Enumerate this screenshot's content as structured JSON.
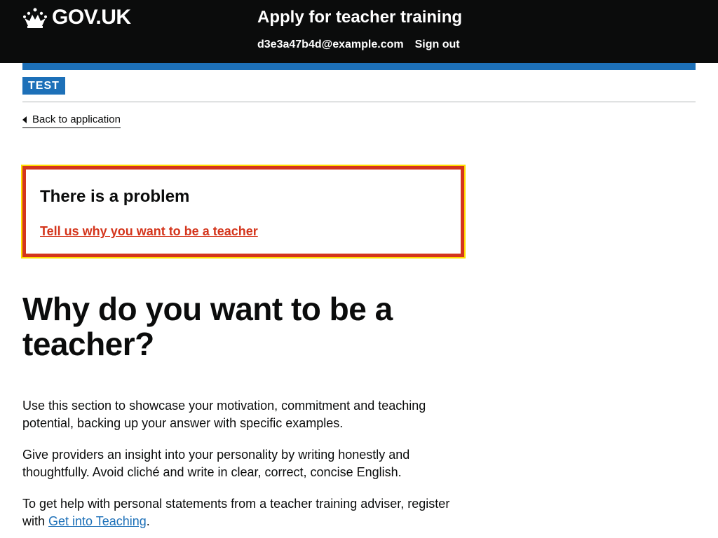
{
  "header": {
    "logo_text": "GOV.UK",
    "service_name": "Apply for teacher training",
    "nav": {
      "email": "d3e3a47b4d@example.com",
      "sign_out": "Sign out"
    }
  },
  "phase_banner": {
    "tag": "TEST"
  },
  "back_link": {
    "label": "Back to application"
  },
  "error_summary": {
    "title": "There is a problem",
    "errors": [
      "Tell us why you want to be a teacher"
    ]
  },
  "main": {
    "title": "Why do you want to be a teacher?",
    "paragraph_1": "Use this section to showcase your motivation, commitment and teaching potential, backing up your answer with specific examples.",
    "paragraph_2": "Give providers an insight into your personality by writing honestly and thoughtfully. Avoid cliché and write in clear, correct, concise English.",
    "paragraph_3_before": "To get help with personal statements from a teacher training adviser, register with ",
    "paragraph_3_link": "Get into Teaching",
    "paragraph_3_after": "."
  },
  "colors": {
    "header_bg": "#0b0c0c",
    "brand_blue": "#1d70b8",
    "error_red": "#d4351c",
    "focus_yellow": "#ffdd00",
    "text": "#0b0c0c"
  },
  "icons": {
    "logo": "crown-icon",
    "back": "chevron-left-icon"
  }
}
